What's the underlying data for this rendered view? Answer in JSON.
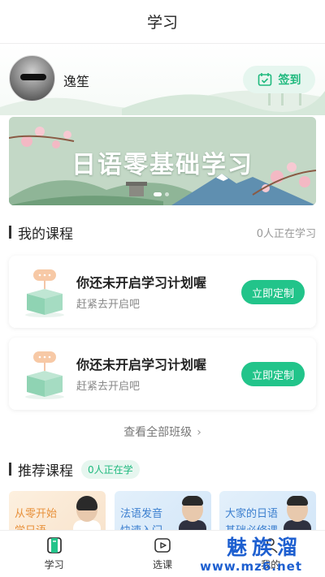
{
  "header": {
    "title": "学习"
  },
  "profile": {
    "username": "逸笙",
    "checkin_label": "签到"
  },
  "banner": {
    "title": "日语零基础学习",
    "slide_count": 2,
    "active_slide": 1
  },
  "my_courses": {
    "title": "我的课程",
    "status": "0人正在学习",
    "cards": [
      {
        "title": "你还未开启学习计划喔",
        "subtitle": "赶紧去开启吧",
        "button": "立即定制"
      },
      {
        "title": "你还未开启学习计划喔",
        "subtitle": "赶紧去开启吧",
        "button": "立即定制"
      }
    ],
    "view_all": "查看全部班级"
  },
  "recommended": {
    "title": "推荐课程",
    "badge": "0人正在学",
    "items": [
      {
        "line1": "从零开始",
        "line2": "学日语",
        "color": "#e8913b"
      },
      {
        "line1": "法语发音",
        "line2": "快速入门",
        "color": "#3c7fcf"
      },
      {
        "line1": "大家的日语",
        "line2": "基础必修课",
        "color": "#3c7fcf"
      }
    ]
  },
  "tabbar": {
    "tabs": [
      {
        "label": "学习",
        "icon": "study-icon",
        "active": true
      },
      {
        "label": "选课",
        "icon": "play-icon",
        "active": false
      },
      {
        "label": "我的",
        "icon": "person-icon",
        "active": false
      }
    ]
  },
  "watermark": {
    "text": "魅族溜",
    "url": "www.mz6.net"
  },
  "colors": {
    "accent": "#22c48a",
    "accent_light": "#e6f6ef",
    "watermark": "#1d5fd0"
  }
}
